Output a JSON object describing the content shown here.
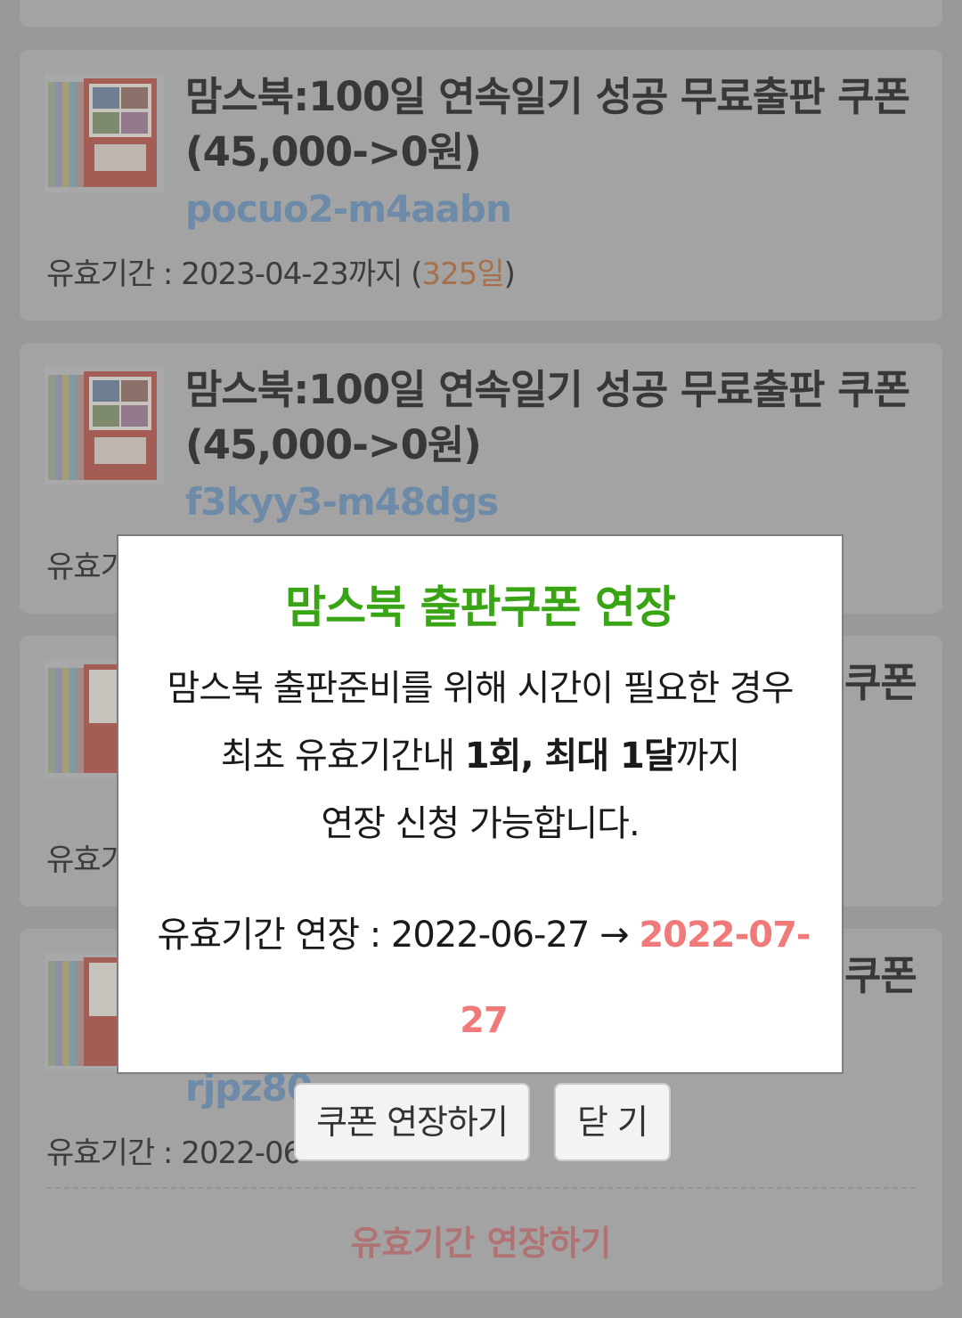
{
  "coupons": [
    {
      "title_line1": "맘스북:100일 연속일기 성공 무료출판 쿠폰",
      "title_line2": "(45,000->0원)",
      "code": "pocuo2-m4aabn",
      "valid_prefix": "유효기간 : 2023-04-23까지 (",
      "valid_days": "325일",
      "valid_suffix": ")"
    },
    {
      "title_line1": "맘스북:100일 연속일기 성공 무료출판 쿠폰",
      "title_line2": "(45,000->0원)",
      "code": "f3kyy3-m48dgs",
      "valid_prefix": "유효기"
    },
    {
      "title_tail": "쿠폰",
      "valid_prefix": "유효기"
    },
    {
      "title_tail": "쿠폰",
      "code": "rjpz80",
      "valid_prefix": "유효기간 : 2022-06",
      "extend_link": "유효기간 연장하기"
    }
  ],
  "modal": {
    "title": "맘스북 출판쿠폰 연장",
    "line1": "맘스북 출판준비를 위해 시간이 필요한 경우",
    "line2_a": "최초 유효기간내 ",
    "line2_b": "1회, 최대 1",
    "line2_c": "달",
    "line2_d": "까지",
    "line3": "연장 신청 가능합니다.",
    "ext_label": "유효기간 연장 : 2022-06-27 → ",
    "ext_new_a": "2022-07-",
    "ext_new_b": "27",
    "confirm_button": "쿠폰 연장하기",
    "close_button": "닫 기"
  },
  "colors": {
    "modal_title": "#3aa514",
    "new_date": "#f07a7a",
    "coupon_code": "#6d8ba8",
    "days_left": "#a6714a"
  }
}
